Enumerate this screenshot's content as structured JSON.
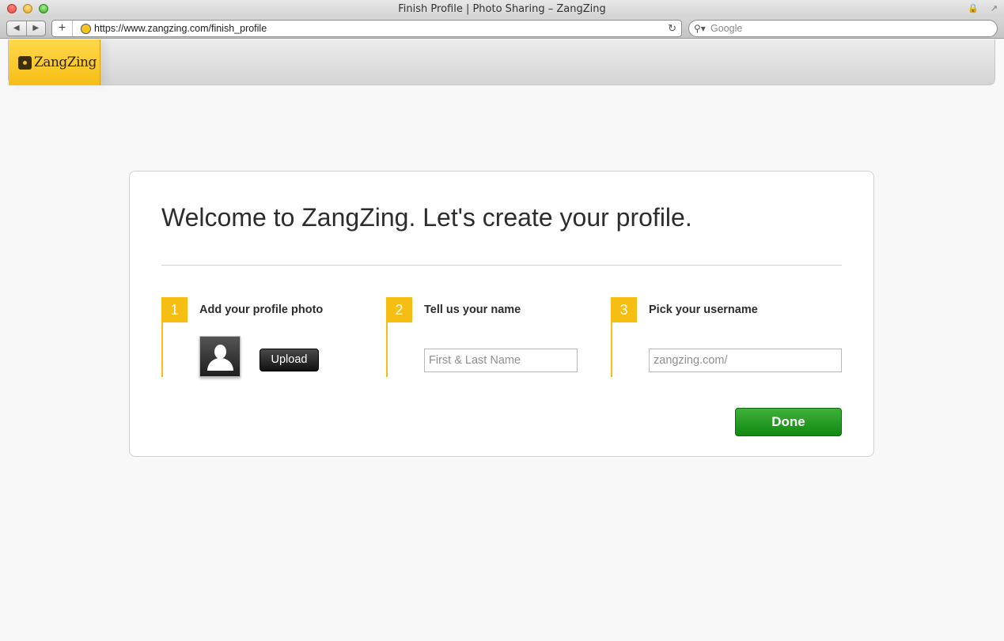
{
  "window": {
    "title": "Finish Profile | Photo Sharing – ZangZing"
  },
  "toolbar": {
    "url": "https://www.zangzing.com/finish_profile",
    "search_placeholder": "Google"
  },
  "app": {
    "logo_text": "ZangZing",
    "brand_color": "#f6bd12"
  },
  "card": {
    "title": "Welcome to ZangZing. Let's create your profile.",
    "steps": [
      {
        "number": "1",
        "label": "Add your profile photo"
      },
      {
        "number": "2",
        "label": "Tell us your name"
      },
      {
        "number": "3",
        "label": "Pick your username"
      }
    ],
    "upload_label": "Upload",
    "name_placeholder": "First & Last Name",
    "username_placeholder": "zangzing.com/",
    "done_label": "Done",
    "done_color": "#1f9a1c"
  },
  "icons": {
    "back": "back-arrow-icon",
    "forward": "forward-arrow-icon",
    "add_tab": "plus-icon",
    "reload": "reload-icon",
    "search": "magnifier-icon",
    "lock": "lock-icon",
    "avatar": "default-avatar-icon"
  }
}
